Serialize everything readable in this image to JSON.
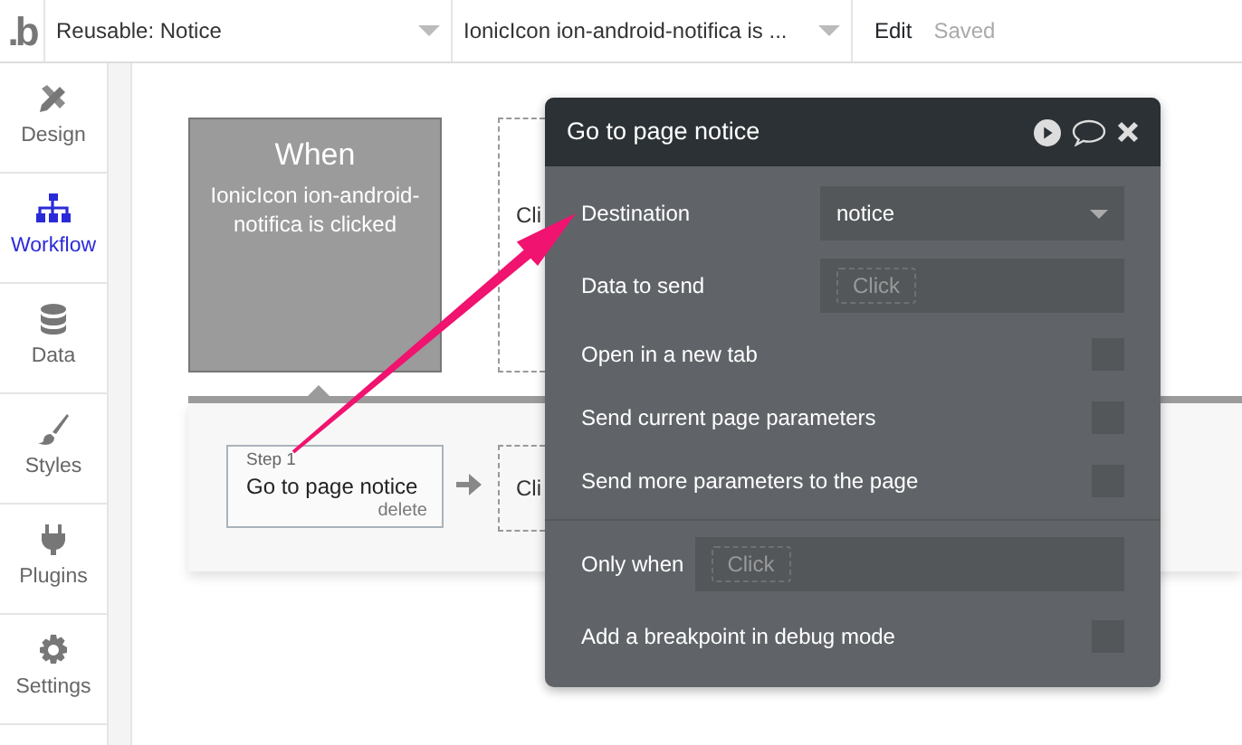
{
  "top_bar": {
    "logo": ".b",
    "page_selector": "Reusable: Notice",
    "event_selector": "IonicIcon ion-android-notifica is ...",
    "edit_link": "Edit",
    "save_status": "Saved"
  },
  "sidebar": {
    "items": [
      {
        "label": "Design",
        "selected": false
      },
      {
        "label": "Workflow",
        "selected": true
      },
      {
        "label": "Data",
        "selected": false
      },
      {
        "label": "Styles",
        "selected": false
      },
      {
        "label": "Plugins",
        "selected": false
      },
      {
        "label": "Settings",
        "selected": false
      }
    ]
  },
  "canvas": {
    "event_card": {
      "heading": "When",
      "description": "IonicIcon ion-android-notifica is clicked"
    },
    "new_event_placeholder": "Cli",
    "step": {
      "step_label": "Step 1",
      "action": "Go to page notice",
      "delete_link": "delete"
    },
    "new_step_placeholder": "Cli"
  },
  "panel": {
    "title": "Go to page notice",
    "options": [
      {
        "kind": "dropdown",
        "label": "Destination",
        "value": "notice"
      },
      {
        "kind": "dynamic",
        "label": "Data to send",
        "placeholder": "Click"
      },
      {
        "kind": "checkbox",
        "label": "Open in a new tab",
        "checked": false
      },
      {
        "kind": "checkbox",
        "label": "Send current page parameters",
        "checked": false
      },
      {
        "kind": "checkbox",
        "label": "Send more parameters to the page",
        "checked": false
      }
    ],
    "conditions": [
      {
        "kind": "condition",
        "label": "Only when",
        "placeholder": "Click"
      },
      {
        "kind": "checkbox",
        "label": "Add a breakpoint in debug mode",
        "checked": false
      }
    ]
  }
}
